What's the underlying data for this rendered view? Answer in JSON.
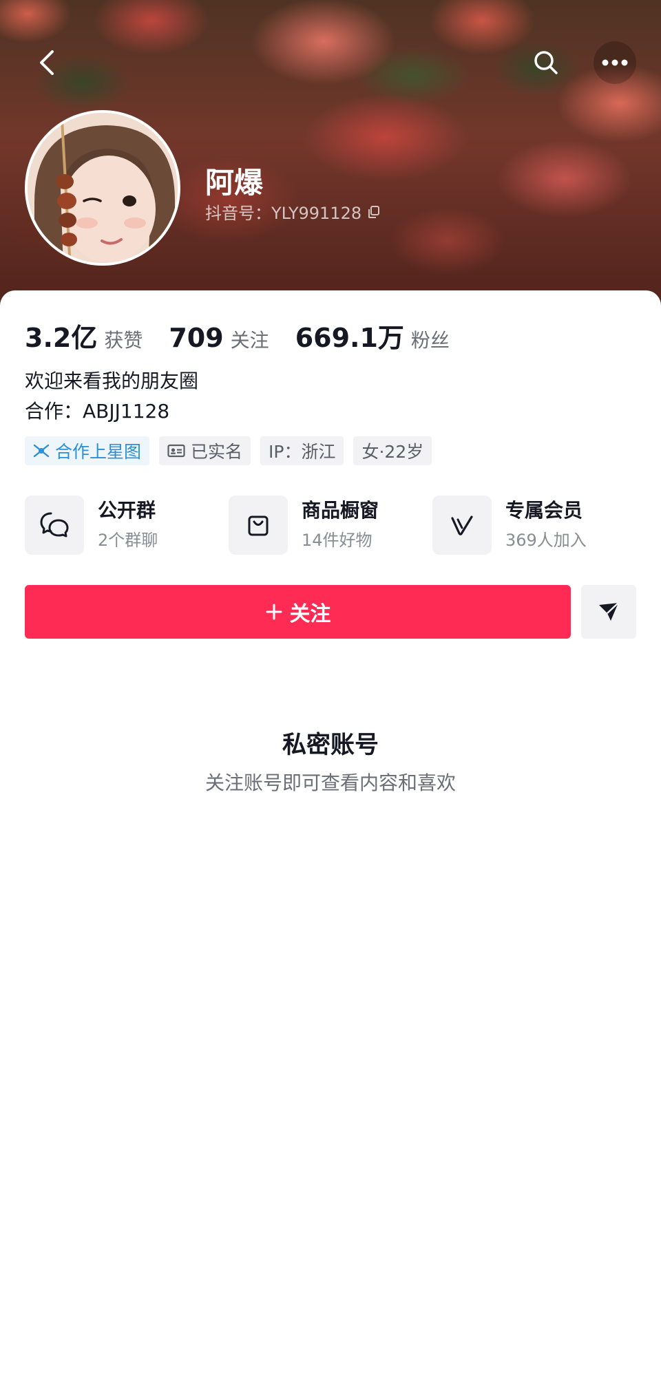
{
  "profile": {
    "name": "阿爆",
    "douyin_id": "抖音号：YLY991128"
  },
  "stats": [
    {
      "value": "3.2亿",
      "label": "获赞"
    },
    {
      "value": "709",
      "label": "关注"
    },
    {
      "value": "669.1万",
      "label": "粉丝"
    }
  ],
  "bio": {
    "line1": "欢迎来看我的朋友圈",
    "line2": "合作：ABJJ1128"
  },
  "tags": {
    "star": "合作上星图",
    "verified": "已实名",
    "ip": "IP：浙江",
    "gender_age": "女·22岁"
  },
  "features": [
    {
      "title": "公开群",
      "sub": "2个群聊",
      "icon": "chat-bubbles-icon"
    },
    {
      "title": "商品橱窗",
      "sub": "14件好物",
      "icon": "shopping-bag-icon"
    },
    {
      "title": "专属会员",
      "sub": "369人加入",
      "icon": "v-member-icon"
    }
  ],
  "actions": {
    "follow_label": "关注",
    "follow_icon": "plus-icon",
    "share_icon": "send-icon"
  },
  "private_notice": {
    "title": "私密账号",
    "subtitle": "关注账号即可查看内容和喜欢"
  },
  "colors": {
    "accent": "#fe2c55",
    "star_tag": "#2a8fd6"
  }
}
